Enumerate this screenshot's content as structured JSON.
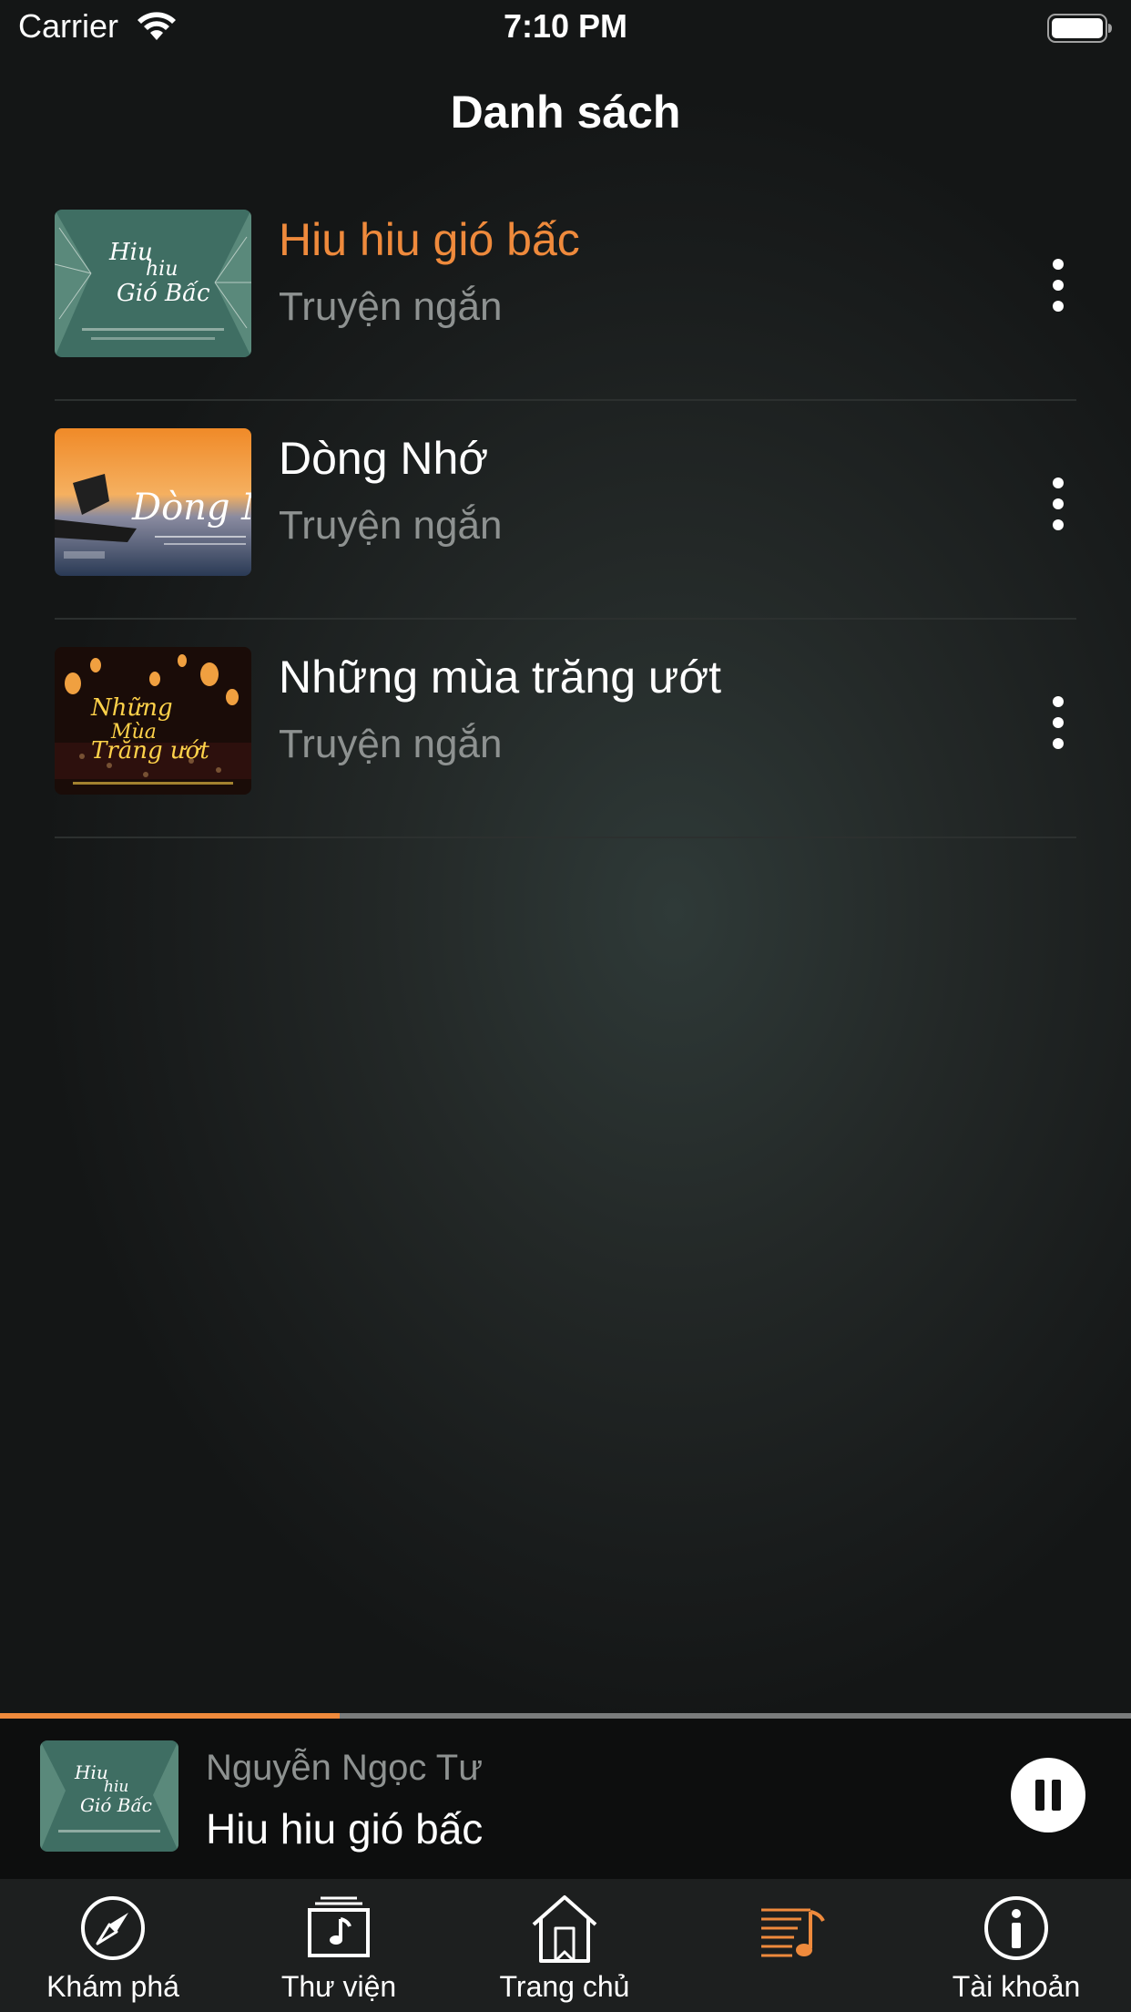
{
  "status_bar": {
    "carrier": "Carrier",
    "time": "7:10 PM",
    "icons": [
      "wifi-icon",
      "battery-icon"
    ]
  },
  "header": {
    "title": "Danh sách"
  },
  "list": {
    "items": [
      {
        "title": "Hiu hiu gió bấc",
        "subtitle": "Truyện ngắn",
        "active": true,
        "thumb_lettering": "Hiu hiu Gió Bấc"
      },
      {
        "title": "Dòng Nhớ",
        "subtitle": "Truyện ngắn",
        "active": false,
        "thumb_lettering": "Dòng Nhớ"
      },
      {
        "title": "Những mùa trăng ướt",
        "subtitle": "Truyện ngắn",
        "active": false,
        "thumb_lettering": "Những Mùa Trăng ướt"
      }
    ]
  },
  "player": {
    "author": "Nguyễn Ngọc Tư",
    "title": "Hiu hiu gió bấc",
    "progress": 0.3,
    "state": "playing",
    "button_icon": "pause-icon"
  },
  "tab_bar": {
    "tabs": [
      {
        "label": "Khám phá",
        "icon": "compass-icon",
        "active": false
      },
      {
        "label": "Thư viện",
        "icon": "music-library-icon",
        "active": false
      },
      {
        "label": "Trang chủ",
        "icon": "home-icon",
        "active": false
      },
      {
        "label": "",
        "icon": "playlist-icon",
        "active": true
      },
      {
        "label": "Tài khoản",
        "icon": "info-icon",
        "active": false
      }
    ]
  },
  "colors": {
    "accent": "#ef8a3c",
    "secondary_text": "#8e9291",
    "tab_bar_bg": "#1d1f1f",
    "player_bg": "#0d0e0e"
  }
}
